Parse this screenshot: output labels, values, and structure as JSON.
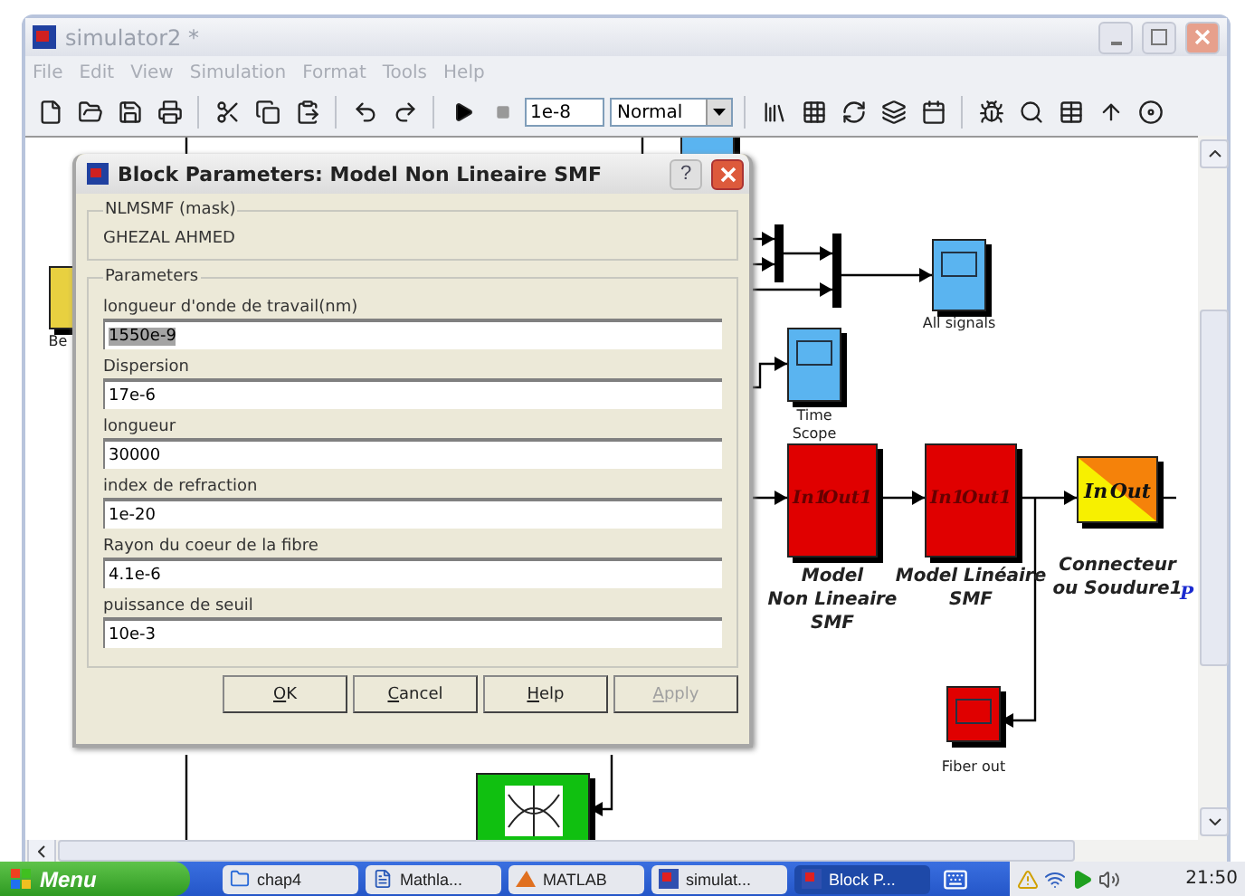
{
  "window": {
    "title": "simulator2 *"
  },
  "menu": [
    "File",
    "Edit",
    "View",
    "Simulation",
    "Format",
    "Tools",
    "Help"
  ],
  "toolbar": {
    "stop_time": "1e-8",
    "mode": "Normal"
  },
  "canvas": {
    "blocks": [
      {
        "kind": "source",
        "label": [
          "Be"
        ],
        "color": "#e8d040"
      },
      {
        "kind": "scope",
        "label": [
          "All signals"
        ],
        "color": "#5ab4f0"
      },
      {
        "kind": "scope",
        "label": [
          "Time",
          "Scope"
        ],
        "color": "#5ab4f0"
      },
      {
        "kind": "subsystem",
        "label": [
          "Model",
          "Non Lineaire",
          "SMF"
        ],
        "ports": [
          "In1",
          "Out1"
        ],
        "color": "#e00000"
      },
      {
        "kind": "subsystem",
        "label": [
          "Model Linéaire",
          "SMF"
        ],
        "ports": [
          "In1",
          "Out1"
        ],
        "color": "#e00000"
      },
      {
        "kind": "connector",
        "label": [
          "Connecteur",
          "ou Soudure1"
        ],
        "ports": [
          "In",
          "Out"
        ],
        "color": "#f7f000"
      },
      {
        "kind": "scope",
        "label": [
          "Fiber out"
        ],
        "color": "#e00000"
      },
      {
        "kind": "eye",
        "color": "#10c010"
      }
    ],
    "cut_label": "P"
  },
  "dialog": {
    "title": "Block Parameters: Model Non Lineaire SMF",
    "help": "?",
    "mask": {
      "title": "NLMSMF (mask)",
      "description": "GHEZAL AHMED"
    },
    "parameters_title": "Parameters",
    "parameters": [
      {
        "label": "longueur d'onde de travail(nm)",
        "value": "1550e-9",
        "selected": true
      },
      {
        "label": "Dispersion",
        "value": "17e-6",
        "selected": false
      },
      {
        "label": "longueur",
        "value": "30000",
        "selected": false
      },
      {
        "label": "index de refraction",
        "value": "1e-20",
        "selected": false
      },
      {
        "label": "Rayon du coeur de la fibre",
        "value": "4.1e-6",
        "selected": false
      },
      {
        "label": "puissance de seuil",
        "value": "10e-3",
        "selected": false
      }
    ],
    "buttons": [
      {
        "label": "OK",
        "disabled": false
      },
      {
        "label": "Cancel",
        "disabled": false
      },
      {
        "label": "Help",
        "disabled": false
      },
      {
        "label": "Apply",
        "disabled": true
      }
    ]
  },
  "taskbar": {
    "start": "Menu",
    "items": [
      {
        "label": "chap4",
        "kind": "folder",
        "selected": false
      },
      {
        "label": "Mathla...",
        "kind": "doc",
        "selected": false
      },
      {
        "label": "MATLAB",
        "kind": "matlab",
        "selected": false
      },
      {
        "label": "simulat...",
        "kind": "model",
        "selected": false
      },
      {
        "label": "Block P...",
        "kind": "model",
        "selected": true
      }
    ],
    "clock": "21:50"
  }
}
